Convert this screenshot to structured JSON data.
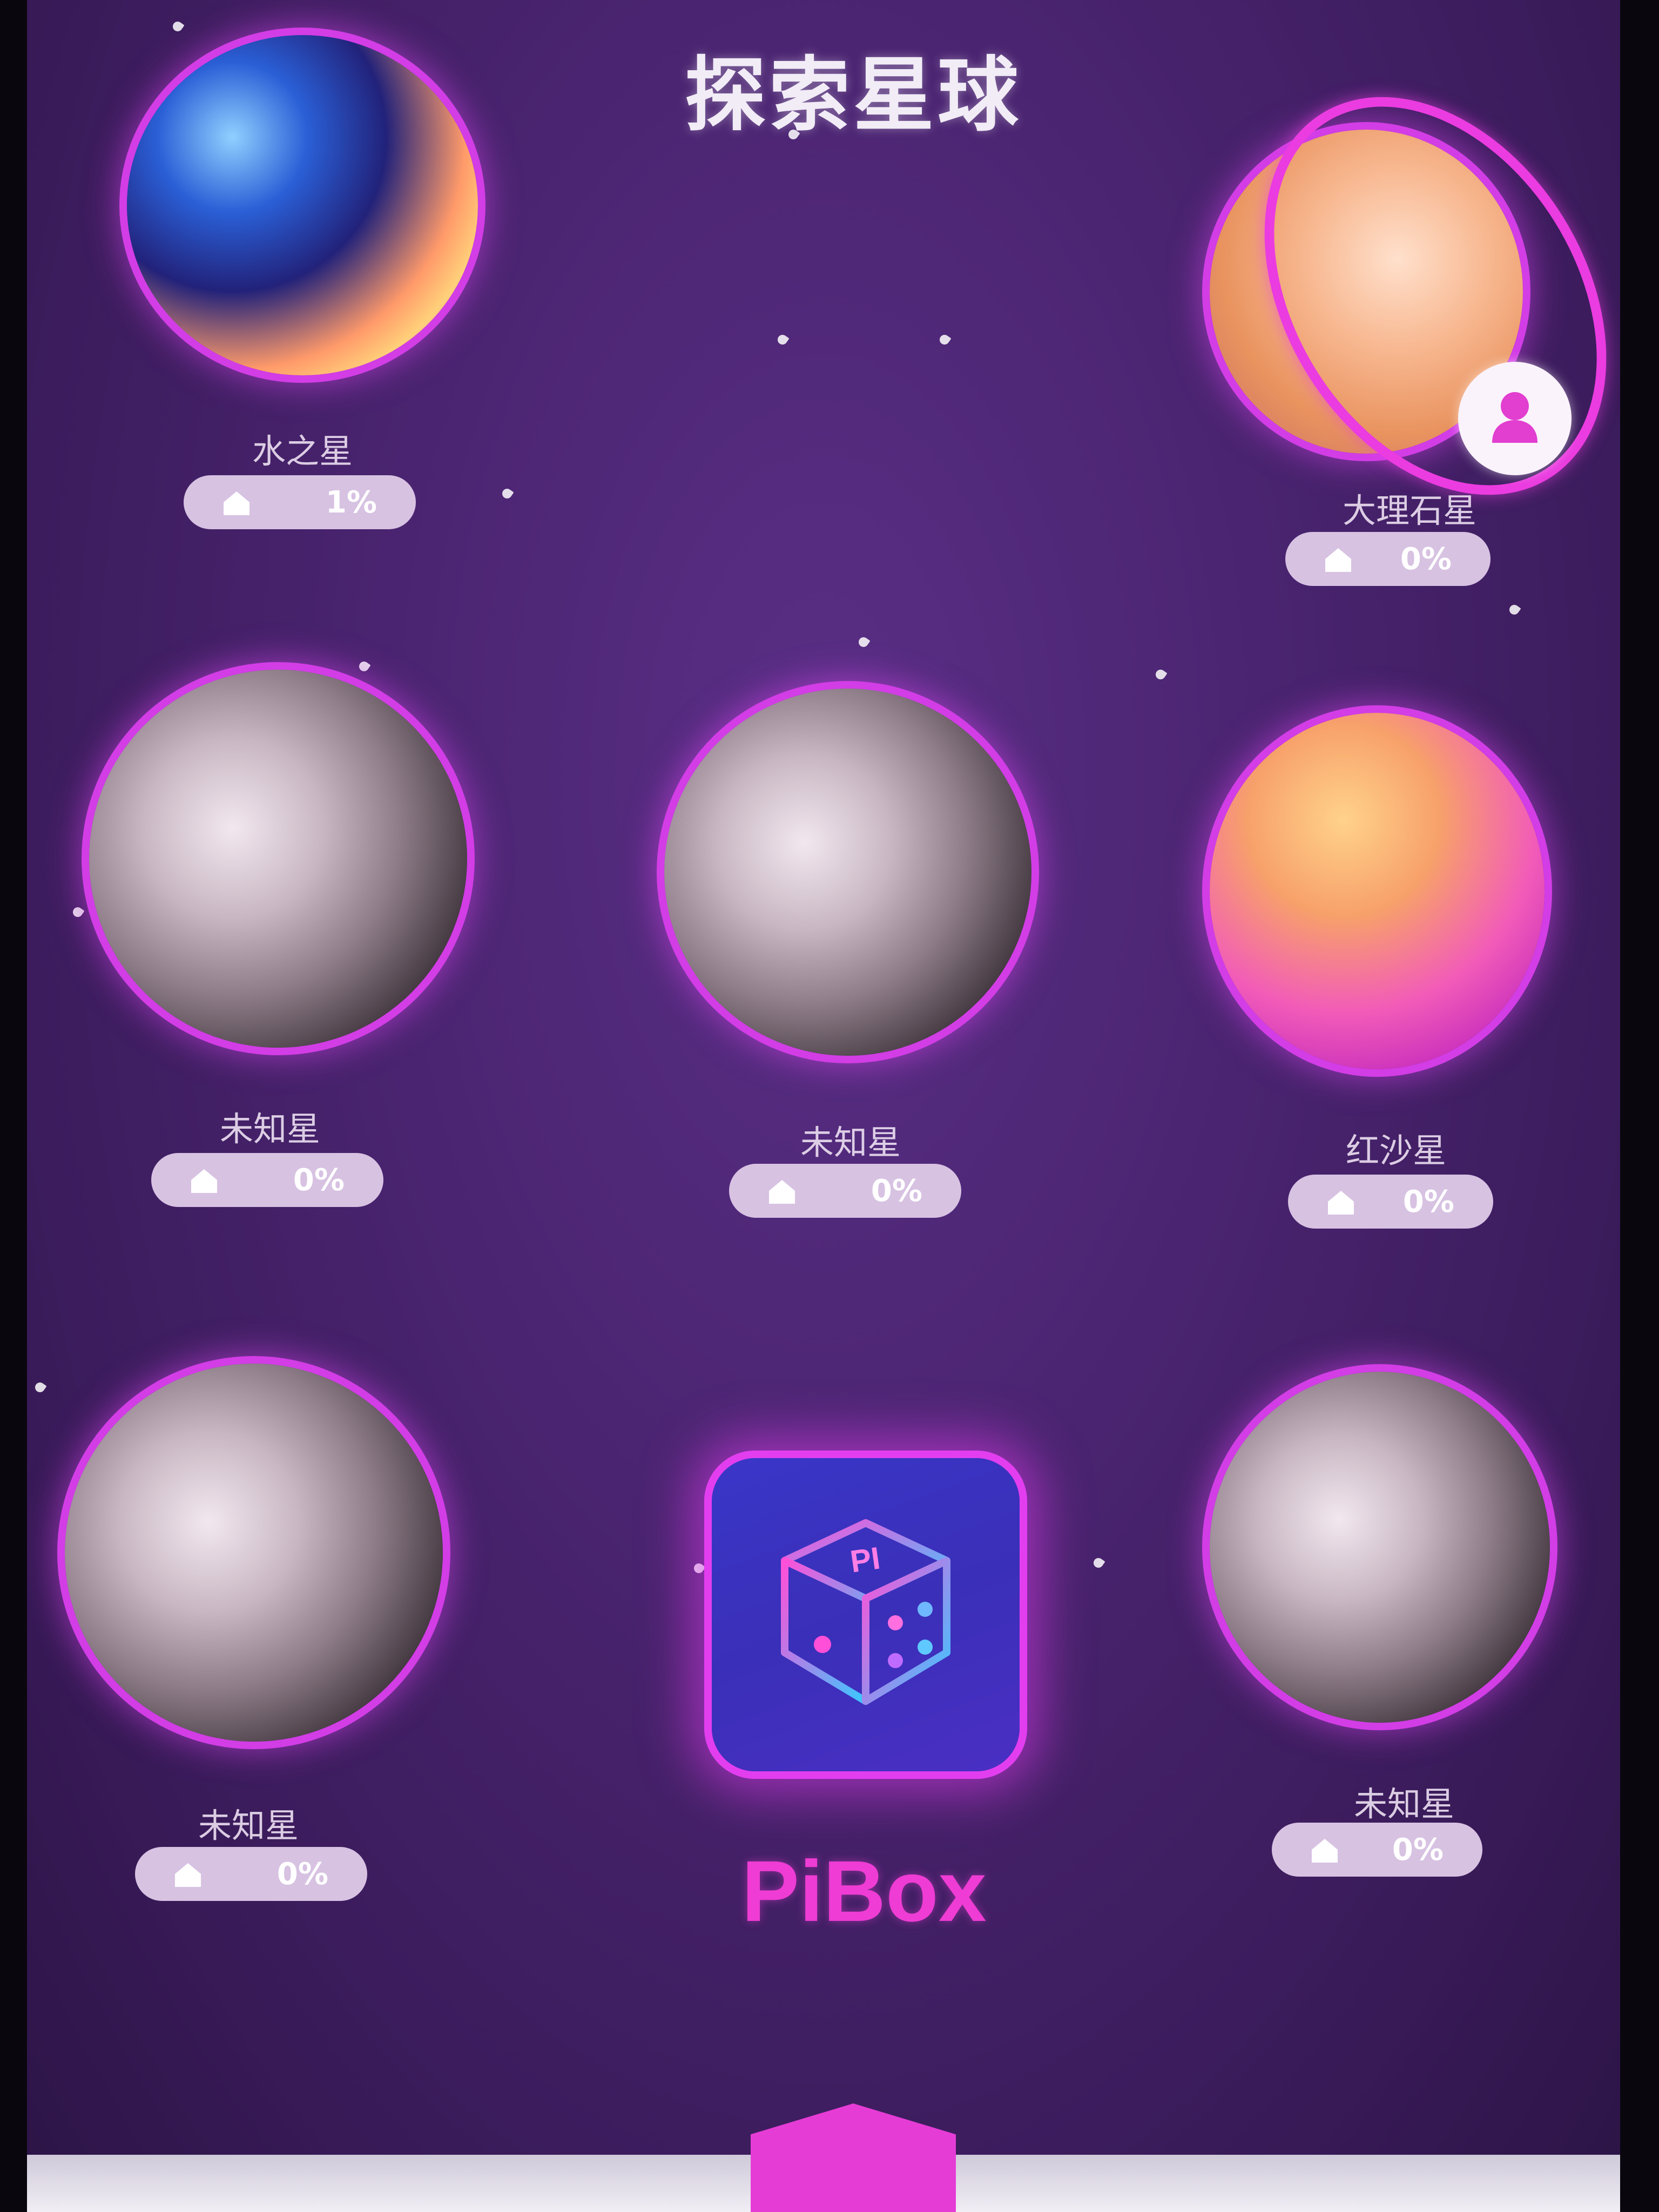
{
  "page_title": "探索星球",
  "planets": [
    {
      "name": "水之星",
      "progress": "1%"
    },
    {
      "name": "大理石星",
      "progress": "0%"
    },
    {
      "name": "未知星",
      "progress": "0%"
    },
    {
      "name": "未知星",
      "progress": "0%"
    },
    {
      "name": "红沙星",
      "progress": "0%"
    },
    {
      "name": "未知星",
      "progress": "0%"
    },
    {
      "name": "未知星",
      "progress": "0%"
    }
  ],
  "center_app": {
    "label": "PiBox",
    "icon": "dice-icon",
    "dice_face_text": "PI"
  },
  "icons": {
    "home": "home-icon",
    "profile": "user-icon",
    "nav": "hexagon-nav-icon"
  },
  "colors": {
    "accent": "#e23ef0",
    "background": "#4a2470",
    "pill": "#d7c2e2",
    "brand_text": "#ee3cd4"
  }
}
